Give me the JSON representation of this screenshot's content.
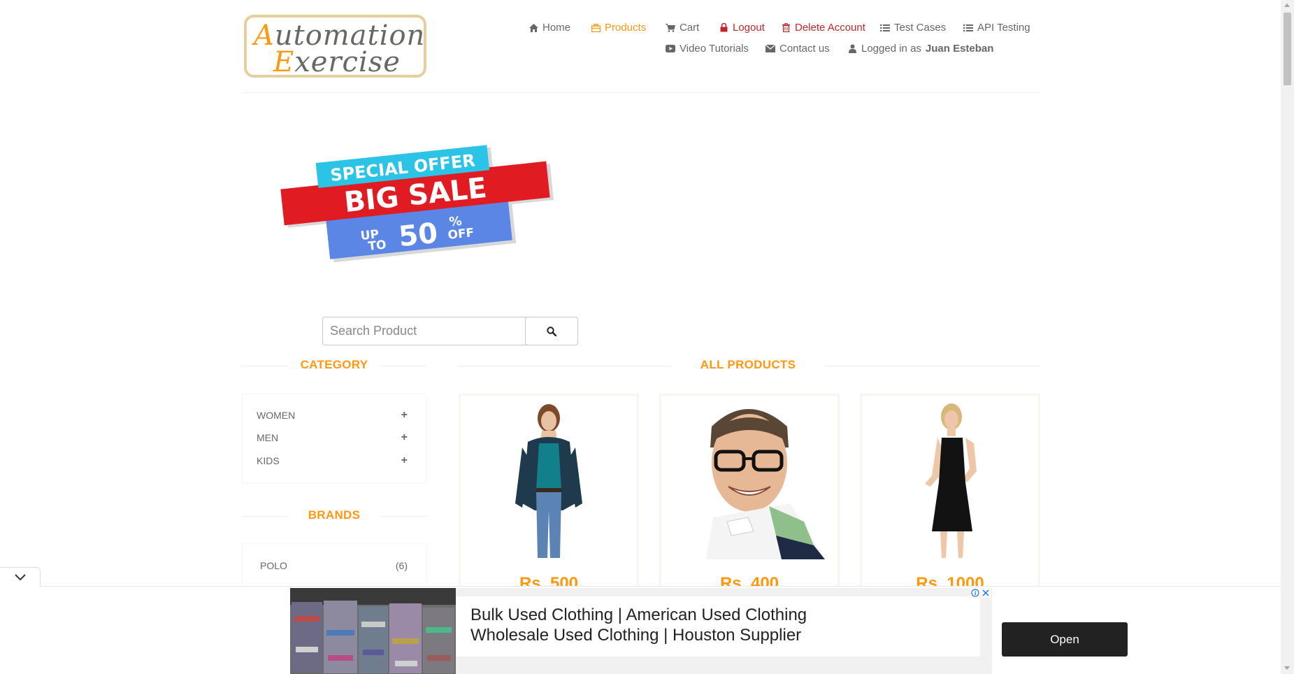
{
  "logo": {
    "line1_cap": "A",
    "line1_rest": "utomation",
    "line2_cap": "E",
    "line2_rest": "xercise"
  },
  "nav": {
    "home": "Home",
    "products": "Products",
    "cart": "Cart",
    "logout": "Logout",
    "delete_account": "Delete Account",
    "test_cases": "Test Cases",
    "api_testing": "API Testing",
    "video_tutorials": "Video Tutorials",
    "contact_us": "Contact us",
    "logged_in_prefix": "Logged in as",
    "logged_in_user": "Juan Esteban"
  },
  "banner": {
    "top": "SPECIAL OFFER",
    "middle": "BIG SALE",
    "up": "UP",
    "to": "TO",
    "amount": "50",
    "percent": "%",
    "off": "OFF"
  },
  "search": {
    "placeholder": "Search Product",
    "value": ""
  },
  "sidebar": {
    "category_title": "Category",
    "categories": [
      {
        "label": "Women",
        "toggle": "+"
      },
      {
        "label": "Men",
        "toggle": "+"
      },
      {
        "label": "Kids",
        "toggle": "+"
      }
    ],
    "brands_title": "Brands",
    "brands": [
      {
        "label": "Polo",
        "count": "(6)"
      }
    ]
  },
  "main": {
    "title": "All Products",
    "products": [
      {
        "price": "Rs. 500"
      },
      {
        "price": "Rs. 400"
      },
      {
        "price": "Rs. 1000"
      }
    ]
  },
  "ad": {
    "line1": "Bulk Used Clothing | American Used Clothing",
    "line2": "Wholesale Used Clothing | Houston Supplier",
    "cta": "Open",
    "info": "i",
    "close": "✕"
  },
  "colors": {
    "accent": "#FE980F",
    "danger": "#C0272D",
    "text": "#696763"
  }
}
